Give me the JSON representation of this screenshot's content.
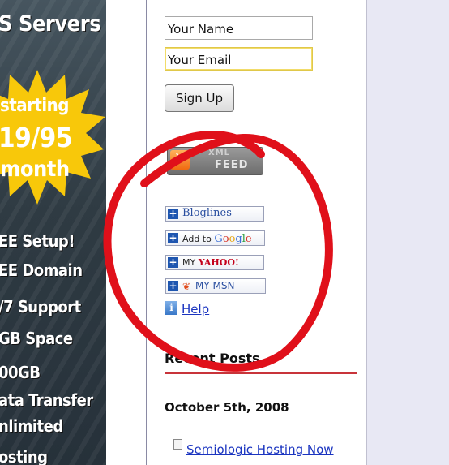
{
  "ad": {
    "title": "S Servers",
    "burst": [
      "starting",
      "19/95",
      "month"
    ],
    "features": [
      "EE Setup!",
      "EE Domain",
      "/7 Support",
      "GB Space",
      "00GB",
      "ata Transfer",
      "nlimited",
      "osting"
    ]
  },
  "signup": {
    "name_value": "Your Name",
    "email_value": "Your Email",
    "button": "Sign Up"
  },
  "rss": {
    "line1": "XML",
    "line2": "FEED"
  },
  "subscribe": {
    "bloglines": "Bloglines",
    "google_prefix": "Add to ",
    "google_brand": "Google",
    "yahoo_prefix": "MY ",
    "yahoo_brand": "YAHOO!",
    "msn": "MY MSN",
    "help": "Help"
  },
  "recent": {
    "heading": "Recent Posts",
    "date": "October 5th, 2008",
    "post": "Semiologic Hosting Now"
  },
  "colors": {
    "annotation": "#e0101a",
    "link": "#1a34c0",
    "divider": "#c8343a"
  }
}
